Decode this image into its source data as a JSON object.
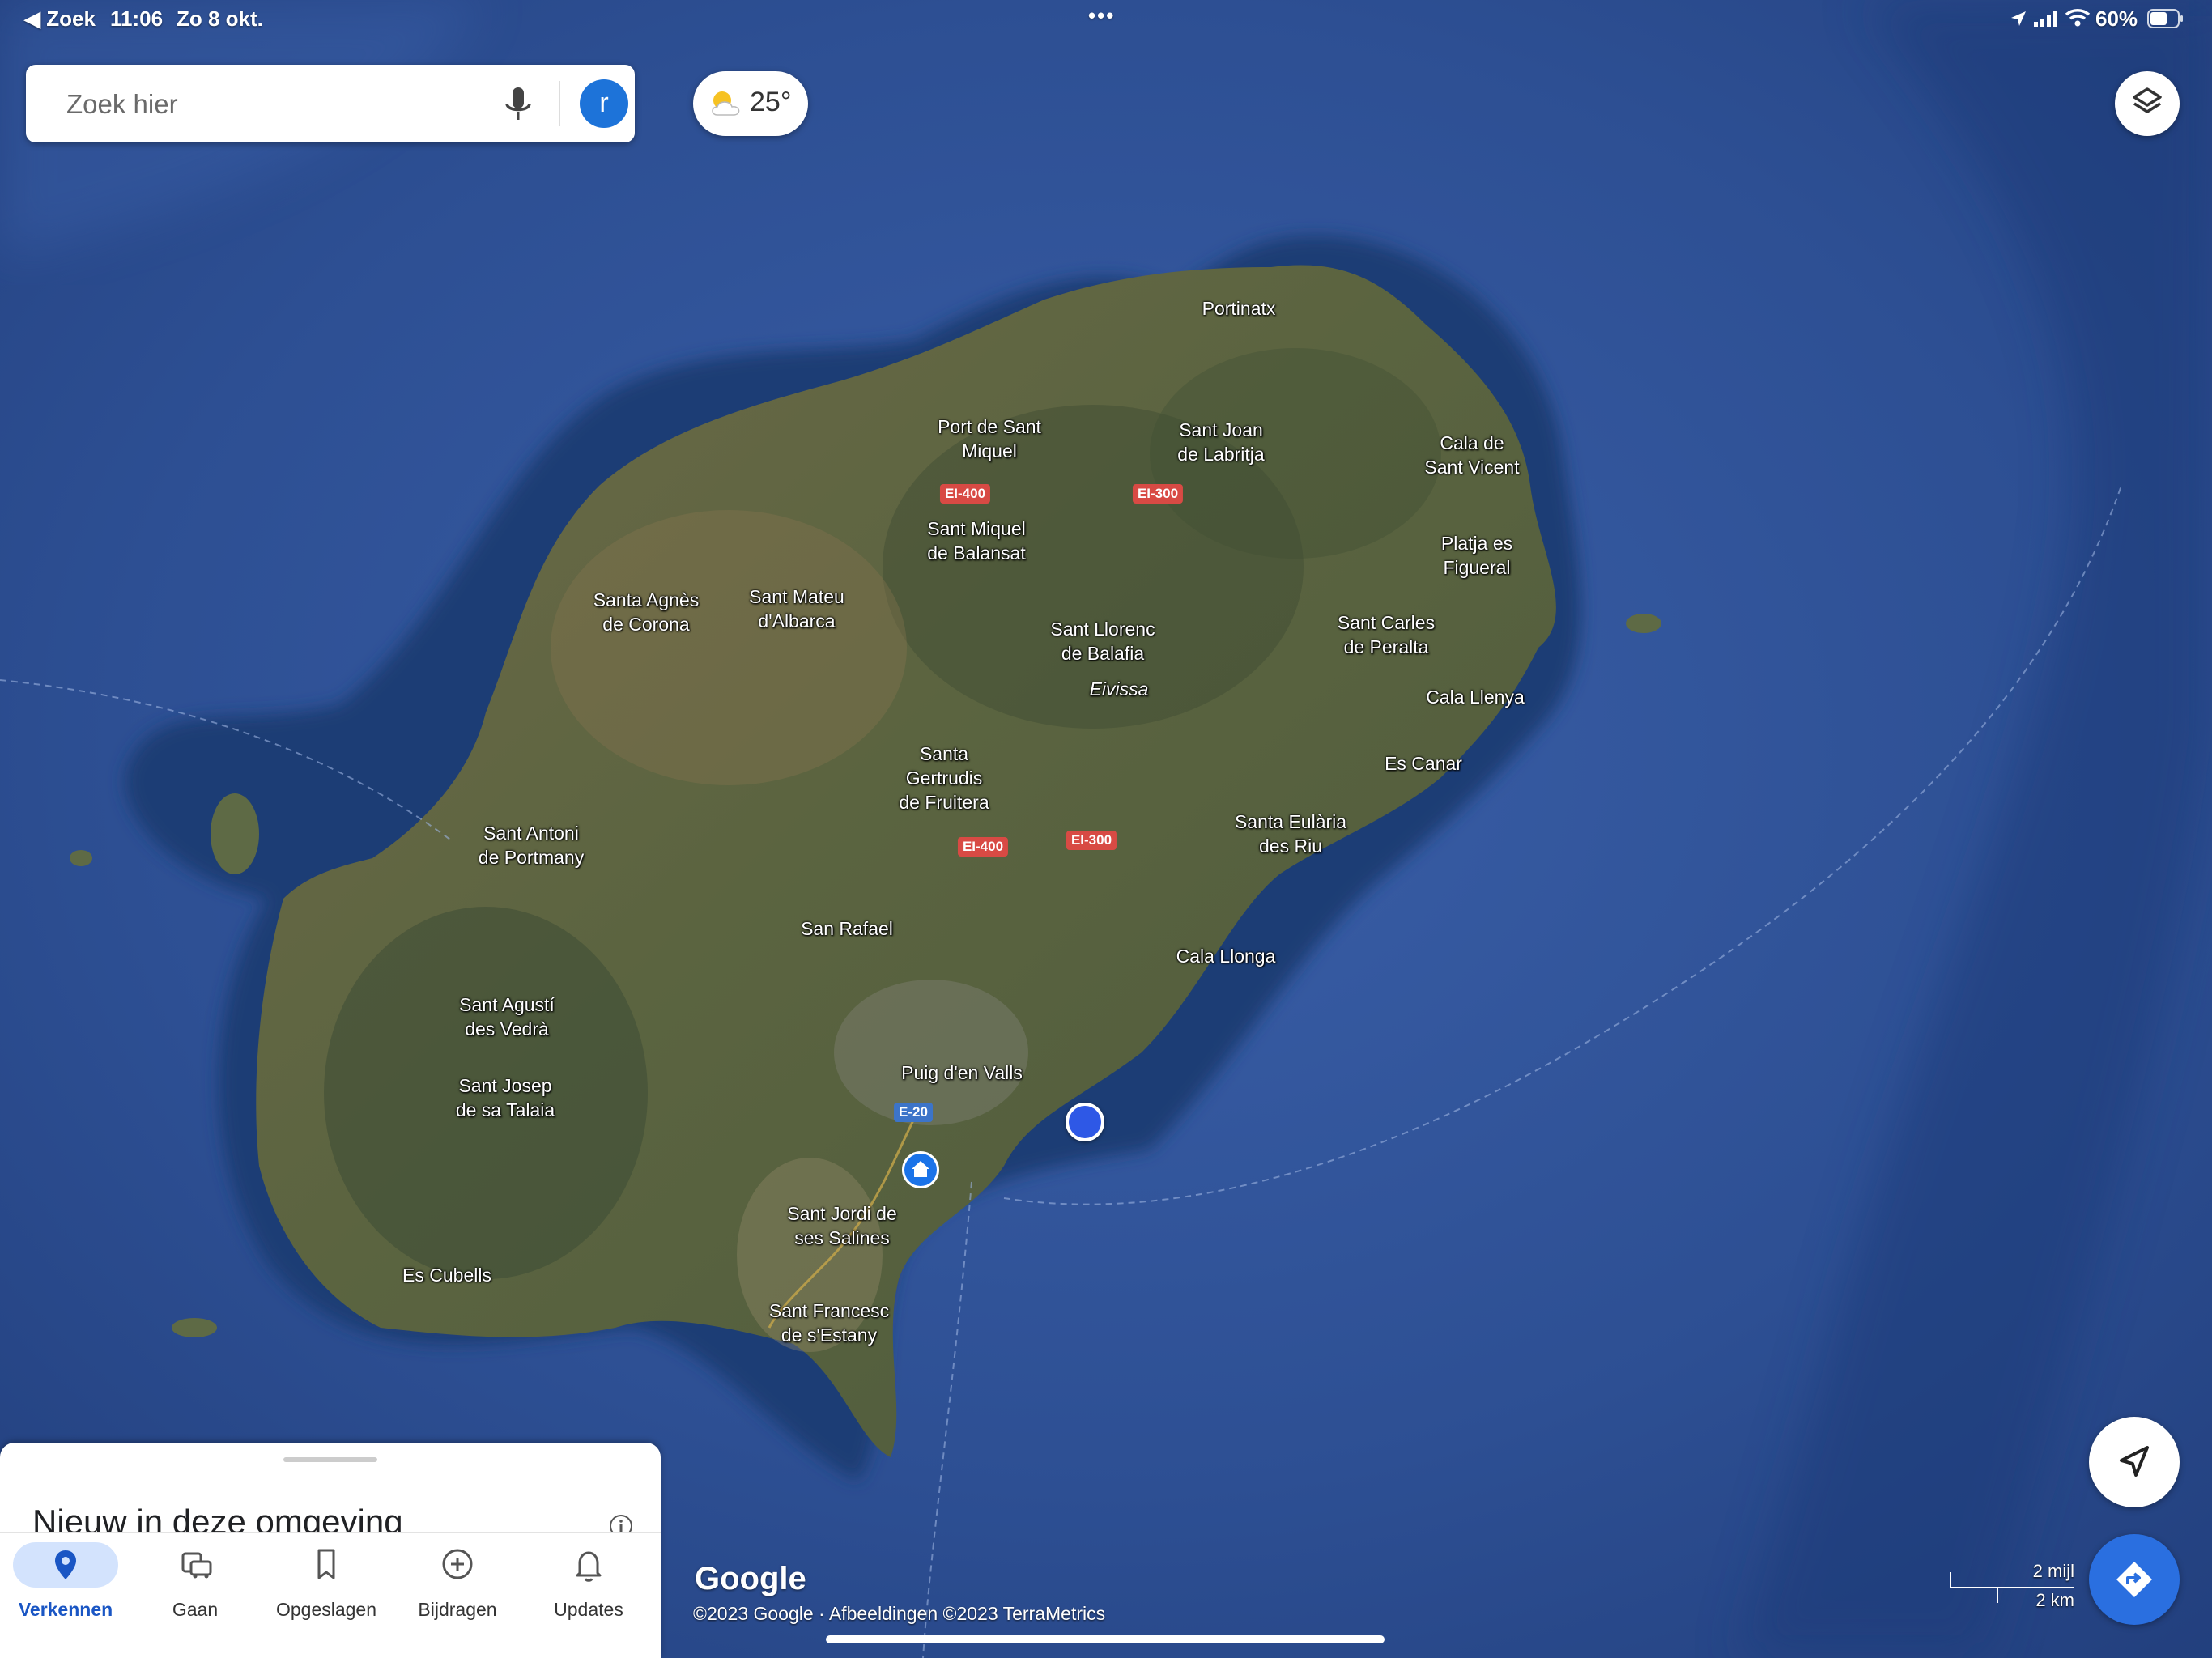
{
  "status_bar": {
    "back_label": "◀ Zoek",
    "time": "11:06",
    "date": "Zo 8 okt.",
    "battery": "60%"
  },
  "search": {
    "placeholder": "Zoek hier",
    "avatar_letter": "r"
  },
  "weather": {
    "temperature": "25°"
  },
  "map": {
    "places": [
      {
        "text": "Portinatx"
      },
      {
        "text": "Port de Sant\nMiquel"
      },
      {
        "text": "Sant Joan\nde Labritja"
      },
      {
        "text": "Cala de\nSant Vicent"
      },
      {
        "text": "Sant Miquel\nde Balansat"
      },
      {
        "text": "Platja es\nFigueral"
      },
      {
        "text": "Santa Agnès\nde Corona"
      },
      {
        "text": "Sant Mateu\nd'Albarca"
      },
      {
        "text": "Sant Llorenc\nde Balafia"
      },
      {
        "text": "Sant Carles\nde Peralta"
      },
      {
        "text": "Eivissa"
      },
      {
        "text": "Cala Llenya"
      },
      {
        "text": "Santa\nGertrudis\nde Fruitera"
      },
      {
        "text": "Es Canar"
      },
      {
        "text": "Sant Antoni\nde Portmany"
      },
      {
        "text": "Santa Eulària\ndes Riu"
      },
      {
        "text": "San Rafael"
      },
      {
        "text": "Cala Llonga"
      },
      {
        "text": "Sant Agustí\ndes Vedrà"
      },
      {
        "text": "Puig d'en Valls"
      },
      {
        "text": "Sant Josep\nde sa Talaia"
      },
      {
        "text": "Sant Jordi de\nses Salines"
      },
      {
        "text": "Es Cubells"
      },
      {
        "text": "Sant Francesc\nde s'Estany"
      }
    ],
    "roads": [
      {
        "text": "EI-400",
        "color": "#d84a44"
      },
      {
        "text": "EI-300",
        "color": "#d84a44"
      },
      {
        "text": "EI-400",
        "color": "#d84a44"
      },
      {
        "text": "EI-300",
        "color": "#d84a44"
      },
      {
        "text": "E-20",
        "color": "#3c74c9"
      }
    ],
    "google_logo": "Google",
    "attribution": "©2023 Google · Afbeeldingen ©2023 TerraMetrics",
    "scale_miles": "2 mijl",
    "scale_km": "2 km"
  },
  "bottom_sheet": {
    "title": "Nieuw in deze omgeving",
    "nav": [
      {
        "label": "Verkennen",
        "icon": "pin-icon",
        "active": true
      },
      {
        "label": "Gaan",
        "icon": "commute-icon",
        "active": false
      },
      {
        "label": "Opgeslagen",
        "icon": "bookmark-icon",
        "active": false
      },
      {
        "label": "Bijdragen",
        "icon": "add-circle-icon",
        "active": false
      },
      {
        "label": "Updates",
        "icon": "bell-icon",
        "active": false
      }
    ]
  },
  "colors": {
    "sea": "#2c4f8f",
    "land": "#6b6a45",
    "accent": "#1a73e8",
    "road_red": "#d84a44",
    "road_blue": "#3c74c9"
  }
}
